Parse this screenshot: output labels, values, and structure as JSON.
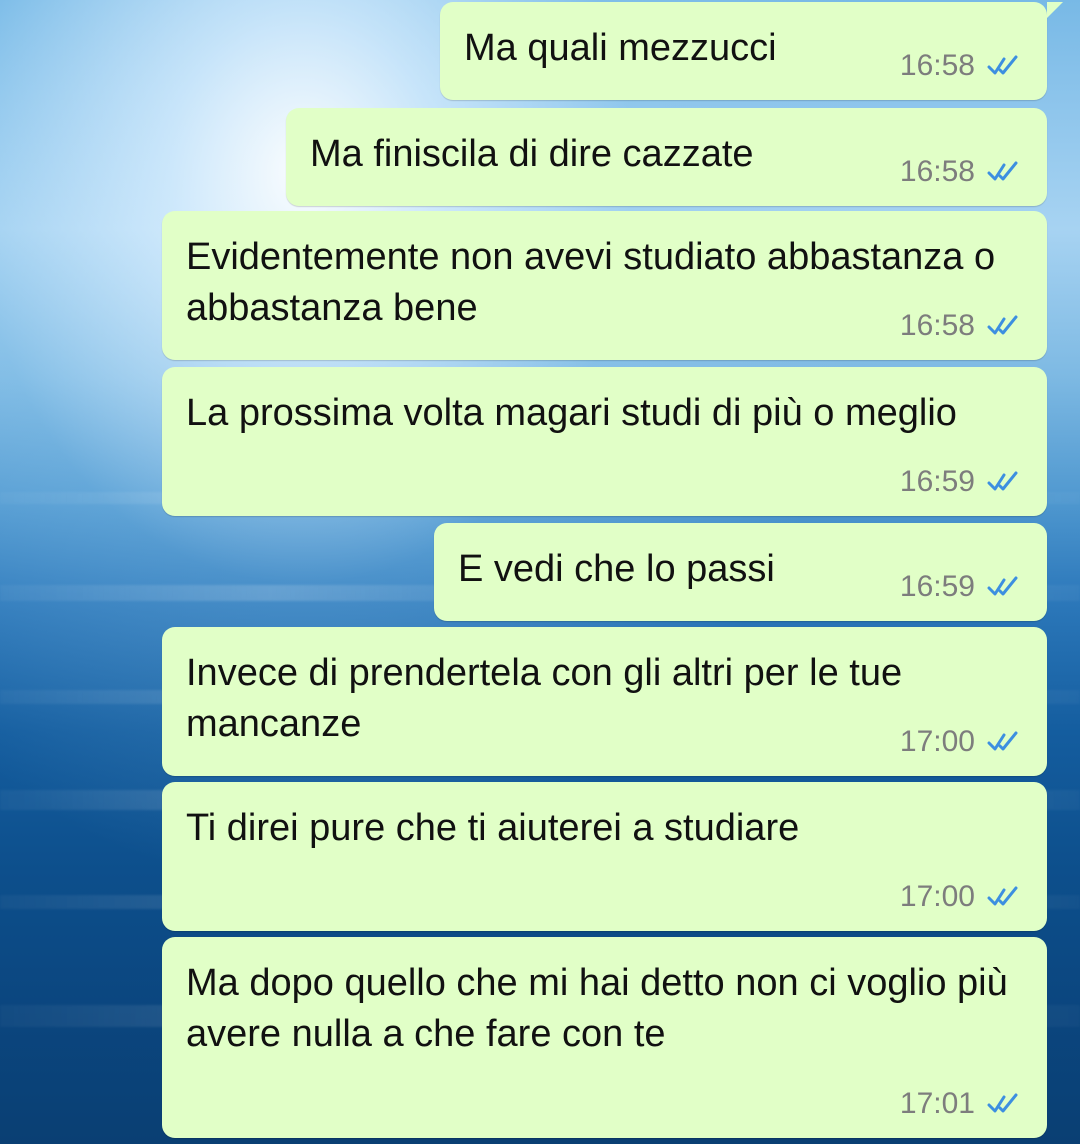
{
  "chat": {
    "messages": [
      {
        "text": "Ma quali mezzucci",
        "time": "16:58",
        "status_icon": "double-check-icon"
      },
      {
        "text": "Ma finiscila di dire cazzate",
        "time": "16:58",
        "status_icon": "double-check-icon"
      },
      {
        "text": "Evidentemente non avevi studiato abbastanza o abbastanza bene",
        "time": "16:58",
        "status_icon": "double-check-icon"
      },
      {
        "text": "La prossima volta magari studi di più o meglio",
        "time": "16:59",
        "status_icon": "double-check-icon"
      },
      {
        "text": "E vedi che lo passi",
        "time": "16:59",
        "status_icon": "double-check-icon"
      },
      {
        "text": "Invece di prendertela con gli altri per le tue mancanze",
        "time": "17:00",
        "status_icon": "double-check-icon"
      },
      {
        "text": "Ti direi pure che ti aiuterei a studiare",
        "time": "17:00",
        "status_icon": "double-check-icon"
      },
      {
        "text": "Ma dopo quello che mi hai detto non ci voglio più avere nulla a che fare con te",
        "time": "17:01",
        "status_icon": "double-check-icon"
      }
    ]
  },
  "colors": {
    "bubble_background": "#e1ffc7",
    "text": "#111111",
    "timestamp": "#7d7d7d",
    "read_ticks": "#3d8fe0"
  }
}
